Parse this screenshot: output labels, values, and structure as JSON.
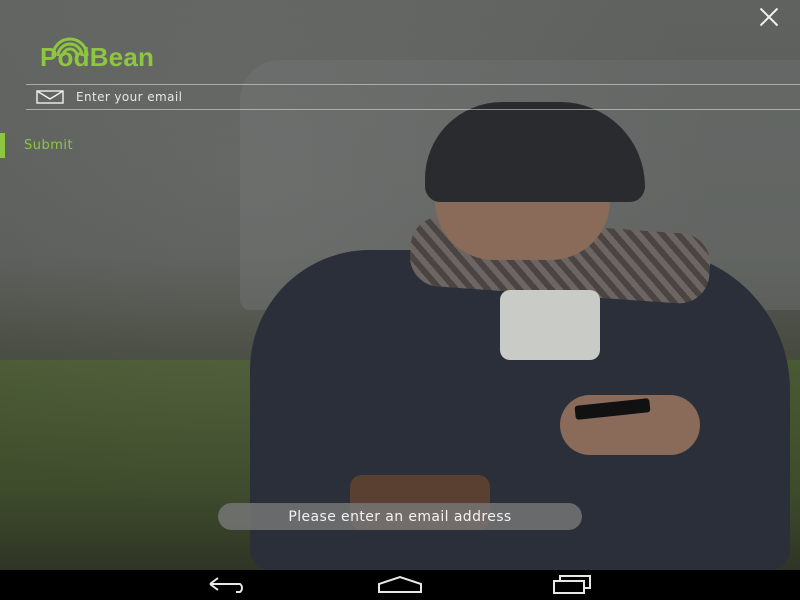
{
  "app": {
    "logo_text": "PodBean",
    "accent_color": "#8ec63f"
  },
  "form": {
    "email_placeholder": "Enter your email",
    "email_value": "",
    "email_icon": "envelope-icon",
    "submit_label": "Submit"
  },
  "toast": {
    "message": "Please enter an email address"
  },
  "window": {
    "close_icon": "close-icon"
  },
  "navbar": {
    "icons": [
      "back-icon",
      "home-icon",
      "recent-apps-icon"
    ]
  }
}
